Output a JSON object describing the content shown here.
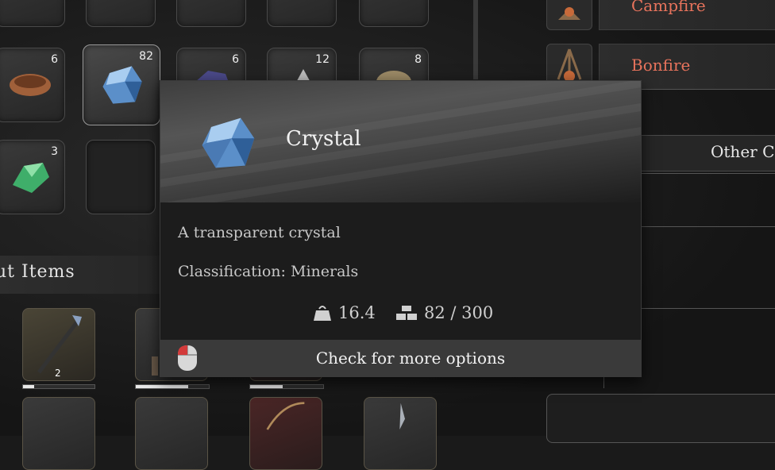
{
  "inventory": {
    "slots": [
      {
        "qty": "6",
        "icon": "wooden-bowl-icon"
      },
      {
        "qty": "82",
        "icon": "crystal-icon",
        "selected": true
      },
      {
        "qty": "6",
        "icon": "ore-icon"
      },
      {
        "qty": "12",
        "icon": "stone-icon"
      },
      {
        "qty": "8",
        "icon": "rock-icon"
      },
      {
        "qty": "3",
        "icon": "green-gem-icon"
      }
    ],
    "section_title": "ut Items",
    "weapons": [
      {
        "qty": "2",
        "durability": 0.15,
        "icon": "spear-icon"
      },
      {
        "qty": "",
        "durability": 0.72,
        "icon": "tool-icon"
      },
      {
        "qty": "",
        "durability": 0.45,
        "icon": "bow-icon"
      }
    ]
  },
  "crafting": {
    "items": [
      {
        "label": "Campfire",
        "icon": "campfire-icon"
      },
      {
        "label": "Bonfire",
        "icon": "bonfire-icon"
      }
    ],
    "other_tab": "Other C"
  },
  "tooltip": {
    "name": "Crystal",
    "description": "A transparent crystal",
    "classification": "Classification: Minerals",
    "weight": "16.4",
    "stack": "82 / 300",
    "footer": "Check for more options",
    "icons": {
      "weight": "weight-icon",
      "stack": "stack-icon",
      "mouse": "mouse-icon"
    }
  },
  "colors": {
    "craft_label": "#e8735c",
    "crystal": "#5b8fc9"
  }
}
